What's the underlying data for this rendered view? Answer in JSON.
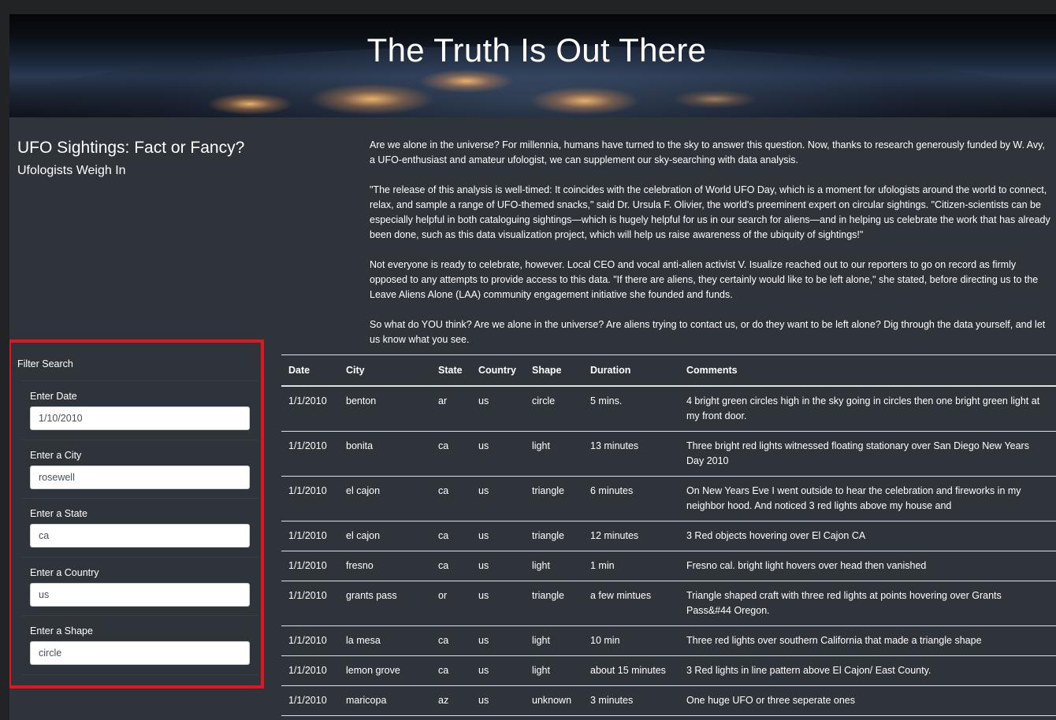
{
  "hero": {
    "title": "The Truth Is Out There"
  },
  "heading": {
    "title": "UFO Sightings: Fact or Fancy?",
    "subtitle": "Ufologists Weigh In"
  },
  "intro": [
    "Are we alone in the universe? For millennia, humans have turned to the sky to answer this question. Now, thanks to research generously funded by W. Avy, a UFO-enthusiast and amateur ufologist, we can supplement our sky-searching with data analysis.",
    "\"The release of this analysis is well-timed: It coincides with the celebration of World UFO Day, which is a moment for ufologists around the world to connect, relax, and sample a range of UFO-themed snacks,\" said Dr. Ursula F. Olivier, the world's preeminent expert on circular sightings. \"Citizen-scientists can be especially helpful in both cataloguing sightings—which is hugely helpful for us in our search for aliens—and in helping us celebrate the work that has already been done, such as this data visualization project, which will help us raise awareness of the ubiquity of sightings!\"",
    "Not everyone is ready to celebrate, however. Local CEO and vocal anti-alien activist V. Isualize reached out to our reporters to go on record as firmly opposed to any attempts to provide access to this data. \"If there are aliens, they certainly would like to be left alone,\" she stated, before directing us to the Leave Aliens Alone (LAA) community engagement initiative she founded and funds.",
    "So what do YOU think? Are we alone in the universe? Are aliens trying to contact us, or do they want to be left alone? Dig through the data yourself, and let us know what you see."
  ],
  "filters": {
    "title": "Filter Search",
    "date": {
      "label": "Enter Date",
      "value": "1/10/2010"
    },
    "city": {
      "label": "Enter a City",
      "value": "rosewell"
    },
    "state": {
      "label": "Enter a State",
      "value": "ca"
    },
    "country": {
      "label": "Enter a Country",
      "value": "us"
    },
    "shape": {
      "label": "Enter a Shape",
      "value": "circle"
    }
  },
  "table": {
    "headers": [
      "Date",
      "City",
      "State",
      "Country",
      "Shape",
      "Duration",
      "Comments"
    ],
    "rows": [
      [
        "1/1/2010",
        "benton",
        "ar",
        "us",
        "circle",
        "5 mins.",
        "4 bright green circles high in the sky going in circles then one bright green light at my front door."
      ],
      [
        "1/1/2010",
        "bonita",
        "ca",
        "us",
        "light",
        "13 minutes",
        "Three bright red lights witnessed floating stationary over San Diego New Years Day 2010"
      ],
      [
        "1/1/2010",
        "el cajon",
        "ca",
        "us",
        "triangle",
        "6 minutes",
        "On New Years Eve I went outside to hear the celebration and fireworks in my neighbor hood. And noticed 3 red lights above my house and"
      ],
      [
        "1/1/2010",
        "el cajon",
        "ca",
        "us",
        "triangle",
        "12 minutes",
        "3 Red objects hovering over El Cajon CA"
      ],
      [
        "1/1/2010",
        "fresno",
        "ca",
        "us",
        "light",
        "1 min",
        "Fresno cal. bright light hovers over head then vanished"
      ],
      [
        "1/1/2010",
        "grants pass",
        "or",
        "us",
        "triangle",
        "a few mintues",
        "Triangle shaped craft with three red lights at points hovering over Grants Pass&#44 Oregon."
      ],
      [
        "1/1/2010",
        "la mesa",
        "ca",
        "us",
        "light",
        "10 min",
        "Three red lights over southern California that made a triangle shape"
      ],
      [
        "1/1/2010",
        "lemon grove",
        "ca",
        "us",
        "light",
        "about 15 minutes",
        "3 Red lights in line pattern above El Cajon/ East County."
      ],
      [
        "1/1/2010",
        "maricopa",
        "az",
        "us",
        "unknown",
        "3 minutes",
        "One huge UFO or three seperate ones"
      ]
    ]
  }
}
